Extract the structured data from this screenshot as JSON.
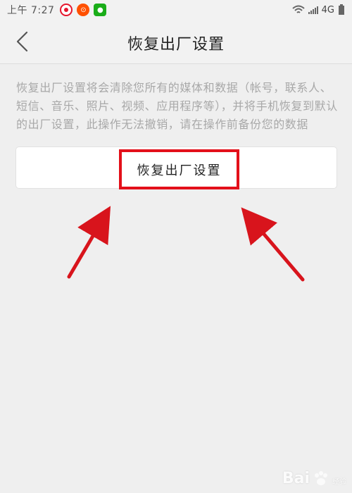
{
  "status_bar": {
    "time": "上午 7:27",
    "network": "4G",
    "icons": [
      "weibo-icon",
      "taobao-icon",
      "wechat-icon",
      "wifi-icon",
      "signal-icon"
    ]
  },
  "header": {
    "back_icon": "chevron-left-icon",
    "title": "恢复出厂设置"
  },
  "content": {
    "description": "恢复出厂设置将会清除您所有的媒体和数据（帐号，联系人、短信、音乐、照片、视频、应用程序等），并将手机恢复到默认的出厂设置，此操作无法撤销，请在操作前备份您的数据",
    "reset_button_label": "恢复出厂设置"
  },
  "annotations": {
    "highlight_color": "#e3101a",
    "arrows": 2
  },
  "watermark": {
    "text": "Bai",
    "icon": "baidu-paw-icon",
    "suffix": "经验"
  }
}
